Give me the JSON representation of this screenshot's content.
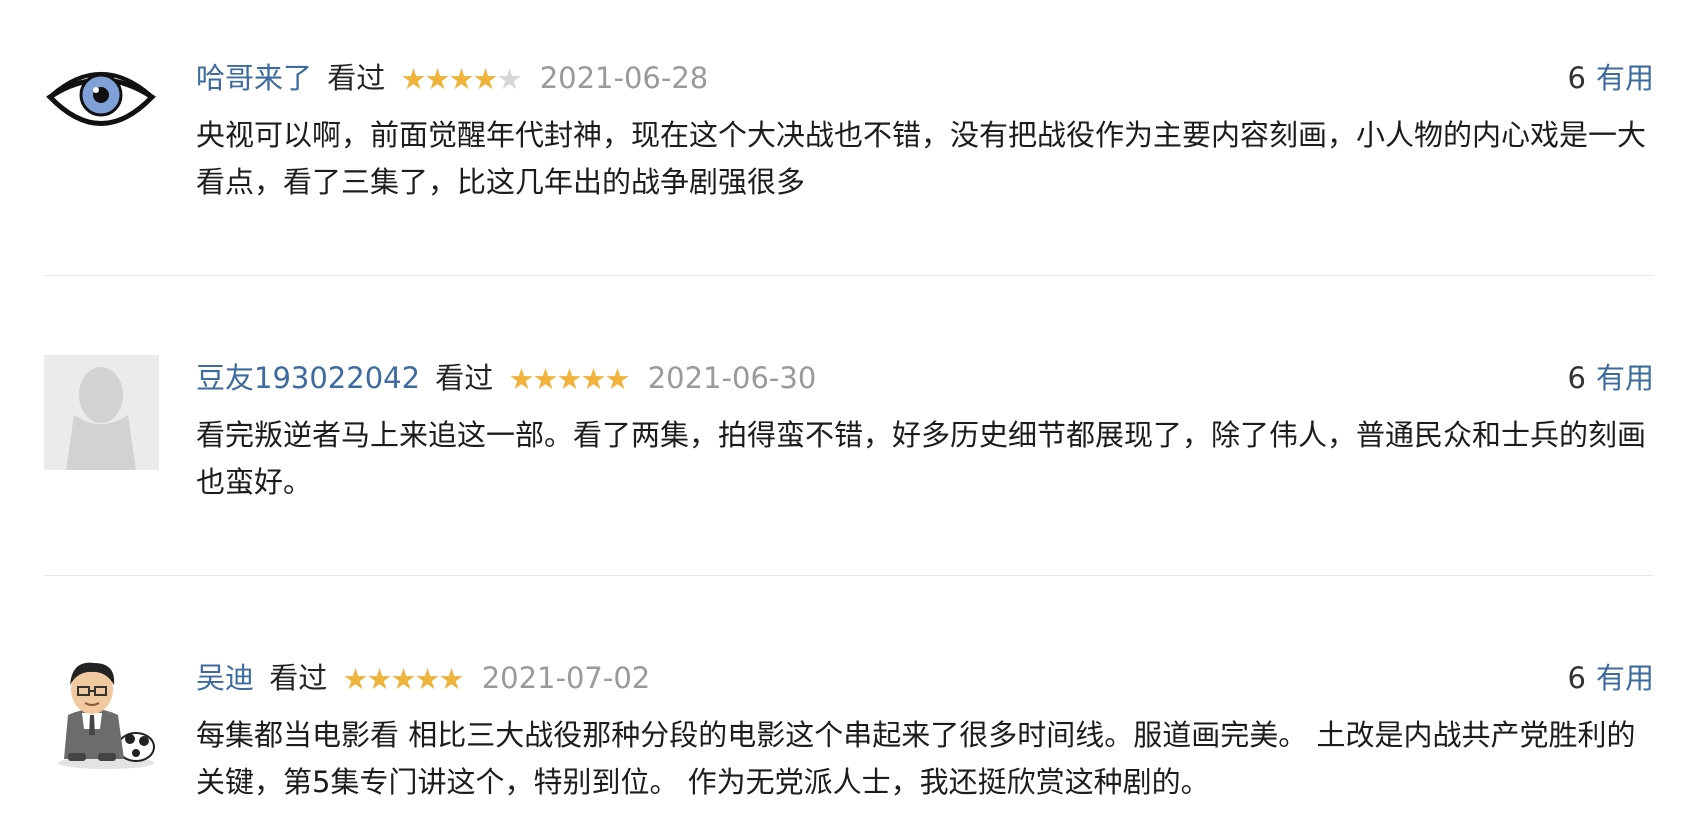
{
  "reviews": [
    {
      "username": "哈哥来了",
      "status": "看过",
      "rating": 4,
      "date": "2021-06-28",
      "votes": "6",
      "useful_label": "有用",
      "text": "央视可以啊，前面觉醒年代封神，现在这个大决战也不错，没有把战役作为主要内容刻画，小人物的内心戏是一大看点，看了三集了，比这几年出的战争剧强很多",
      "avatar": "eye-avatar"
    },
    {
      "username": "豆友193022042",
      "status": "看过",
      "rating": 5,
      "date": "2021-06-30",
      "votes": "6",
      "useful_label": "有用",
      "text": "看完叛逆者马上来追这一部。看了两集，拍得蛮不错，好多历史细节都展现了，除了伟人，普通民众和士兵的刻画也蛮好。",
      "avatar": "default-avatar"
    },
    {
      "username": "吴迪",
      "status": "看过",
      "rating": 5,
      "date": "2021-07-02",
      "votes": "6",
      "useful_label": "有用",
      "text": "每集都当电影看 相比三大战役那种分段的电影这个串起来了很多时间线。服道画完美。 土改是内战共产党胜利的关键，第5集专门讲这个，特别到位。 作为无党派人士，我还挺欣赏这种剧的。",
      "avatar": "cartoon-person-avatar"
    }
  ],
  "colors": {
    "link": "#3d6ba0",
    "star_on": "#f0b33b",
    "star_off": "#d6d6d6",
    "date": "#9a9a9a",
    "divider": "#e8e8e8"
  }
}
